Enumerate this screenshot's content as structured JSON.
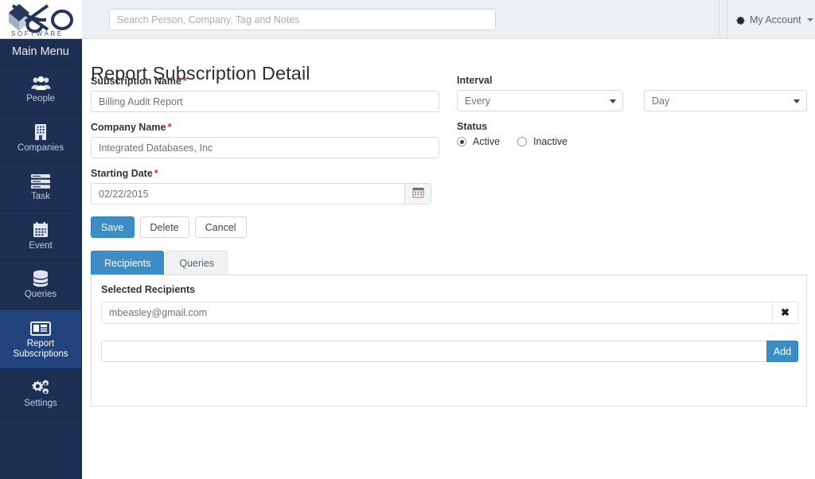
{
  "brand": {
    "name": "XEO",
    "tagline": "S O F T W A R E"
  },
  "topbar": {
    "search_placeholder": "Search Person, Company, Tag and Notes",
    "search_value": "",
    "account_label": "My Account",
    "account_icon": "gear-icon",
    "caret_icon": "chevron-down-icon"
  },
  "sidebar": {
    "heading": "Main Menu",
    "items": [
      {
        "label": "People",
        "icon": "people-icon",
        "active": false
      },
      {
        "label": "Companies",
        "icon": "building-icon",
        "active": false
      },
      {
        "label": "Task",
        "icon": "list-icon",
        "active": false
      },
      {
        "label": "Event",
        "icon": "calendar-icon",
        "active": false
      },
      {
        "label": "Queries",
        "icon": "database-icon",
        "active": false
      },
      {
        "label": "Report Subscriptions",
        "icon": "newspaper-icon",
        "active": true
      },
      {
        "label": "Settings",
        "icon": "gears-icon",
        "active": false
      }
    ]
  },
  "page": {
    "title": "Report Subscription Detail"
  },
  "form": {
    "subscription_name": {
      "label": "Subscription Name",
      "required_marker": "*",
      "value": "Billing Audit Report"
    },
    "company_name": {
      "label": "Company Name",
      "required_marker": "*",
      "value": "Integrated Databases, Inc"
    },
    "starting_date": {
      "label": "Starting Date",
      "required_marker": "*",
      "value": "02/22/2015",
      "calendar_icon": "calendar-icon"
    },
    "interval": {
      "label": "Interval",
      "frequency_value": "Every",
      "unit_value": "Day"
    },
    "status": {
      "label": "Status",
      "options": [
        {
          "label": "Active",
          "selected": true
        },
        {
          "label": "Inactive",
          "selected": false
        }
      ]
    }
  },
  "actions": {
    "save": "Save",
    "delete": "Delete",
    "cancel": "Cancel"
  },
  "tabs": [
    {
      "label": "Recipients",
      "active": true
    },
    {
      "label": "Queries",
      "active": false
    }
  ],
  "recipients_panel": {
    "section_label": "Selected Recipients",
    "rows": [
      {
        "email": "mbeasley@gmail.com",
        "remove_icon": "close-icon",
        "remove_glyph": "✖"
      }
    ],
    "add_input_value": "",
    "add_input_placeholder": "",
    "add_button_label": "Add"
  },
  "colors": {
    "sidebar_bg": "#1d3054",
    "sidebar_active_bg": "#23437e",
    "accent_blue": "#3c8dc5",
    "topbar_bg": "#edf0f2",
    "required_red": "#e03030"
  }
}
